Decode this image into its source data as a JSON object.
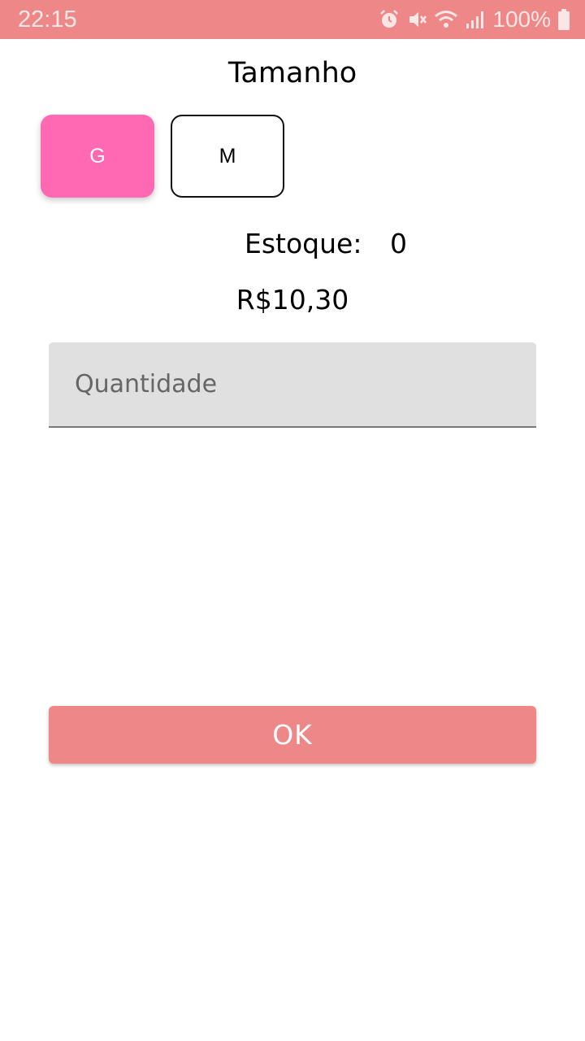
{
  "status_bar": {
    "time": "22:15",
    "battery_percent": "100%",
    "icons": [
      "alarm-icon",
      "vibrate-mute-icon",
      "wifi-icon",
      "signal-icon",
      "battery-icon"
    ]
  },
  "product": {
    "size_title": "Tamanho",
    "sizes": [
      {
        "label": "G",
        "selected": true
      },
      {
        "label": "M",
        "selected": false
      }
    ],
    "stock_label": "Estoque:",
    "stock_value": "0",
    "price": "R$10,30"
  },
  "quantity": {
    "placeholder": "Quantidade",
    "value": ""
  },
  "actions": {
    "ok_label": "OK"
  },
  "colors": {
    "accent": "#ee8888",
    "selected_chip": "#ff69b4",
    "field_background": "#e0e0e0"
  }
}
